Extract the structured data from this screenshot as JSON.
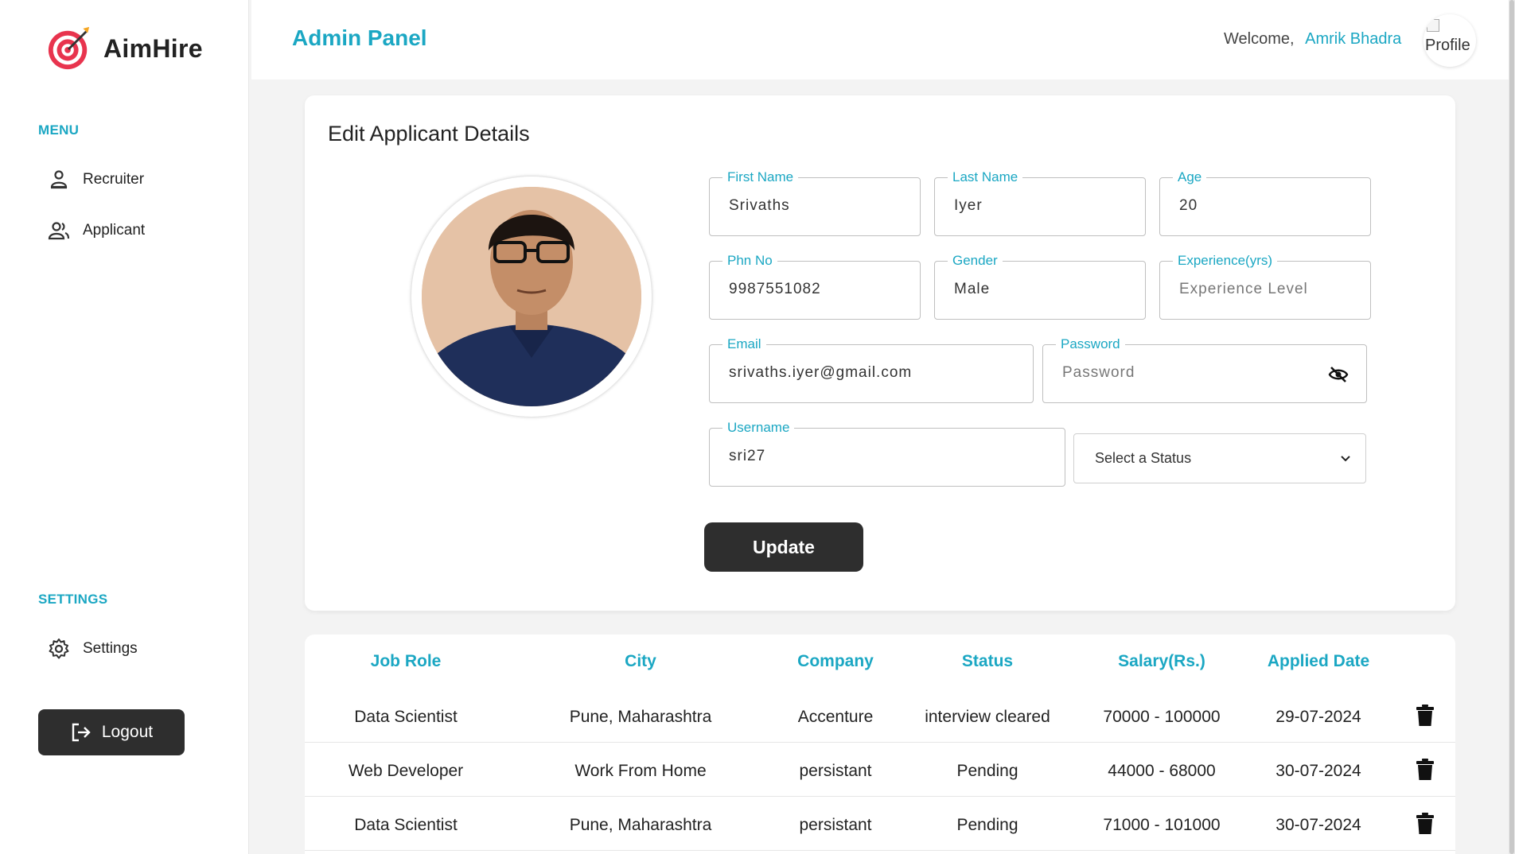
{
  "brand": {
    "name": "AimHire",
    "accent": "#1ba7c3",
    "logo_icon": "target-icon"
  },
  "sidebar": {
    "menu_title": "MENU",
    "items": [
      {
        "label": "Recruiter",
        "icon": "recruiter-icon"
      },
      {
        "label": "Applicant",
        "icon": "applicants-icon"
      }
    ],
    "settings_title": "SETTINGS",
    "settings_item": {
      "label": "Settings",
      "icon": "gear-icon"
    },
    "logout_label": "Logout"
  },
  "header": {
    "title": "Admin Panel",
    "welcome": "Welcome,",
    "user_name": "Amrik Bhadra",
    "profile_alt": "Profile"
  },
  "edit_form": {
    "title": "Edit Applicant Details",
    "first_name": {
      "label": "First Name",
      "value": "Srivaths"
    },
    "last_name": {
      "label": "Last Name",
      "value": "Iyer"
    },
    "age": {
      "label": "Age",
      "value": "20"
    },
    "phone": {
      "label": "Phn No",
      "value": "9987551082"
    },
    "gender": {
      "label": "Gender",
      "value": "Male"
    },
    "experience": {
      "label": "Experience(yrs)",
      "placeholder": "Experience Level"
    },
    "email": {
      "label": "Email",
      "value": "srivaths.iyer@gmail.com"
    },
    "password": {
      "label": "Password",
      "placeholder": "Password"
    },
    "username": {
      "label": "Username",
      "value": "sri27"
    },
    "status_select": {
      "selected": "Select a Status"
    },
    "update_label": "Update"
  },
  "applications": {
    "headers": [
      "Job Role",
      "City",
      "Company",
      "Status",
      "Salary(Rs.)",
      "Applied Date"
    ],
    "rows": [
      [
        "Data Scientist",
        "Pune, Maharashtra",
        "Accenture",
        "interview cleared",
        "70000 - 100000",
        "29-07-2024"
      ],
      [
        "Web Developer",
        "Work From Home",
        "persistant",
        "Pending",
        "44000 - 68000",
        "30-07-2024"
      ],
      [
        "Data Scientist",
        "Pune, Maharashtra",
        "persistant",
        "Pending",
        "71000 - 101000",
        "30-07-2024"
      ]
    ]
  }
}
